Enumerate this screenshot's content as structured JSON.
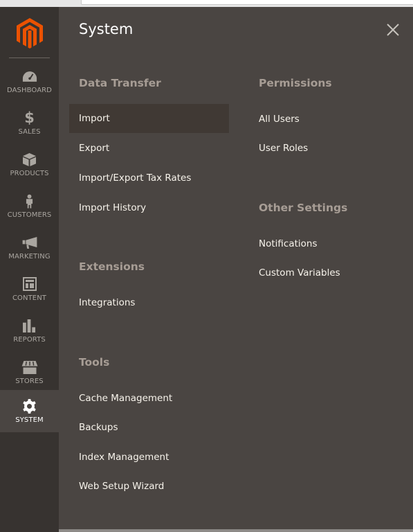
{
  "sidebar": {
    "logo": "magento-logo",
    "items": [
      {
        "label": "DASHBOARD",
        "icon": "dashboard-icon",
        "active": false
      },
      {
        "label": "SALES",
        "icon": "dollar-icon",
        "active": false
      },
      {
        "label": "PRODUCTS",
        "icon": "box-icon",
        "active": false
      },
      {
        "label": "CUSTOMERS",
        "icon": "person-icon",
        "active": false
      },
      {
        "label": "MARKETING",
        "icon": "megaphone-icon",
        "active": false
      },
      {
        "label": "CONTENT",
        "icon": "layout-icon",
        "active": false
      },
      {
        "label": "REPORTS",
        "icon": "bar-chart-icon",
        "active": false
      },
      {
        "label": "STORES",
        "icon": "storefront-icon",
        "active": false
      },
      {
        "label": "SYSTEM",
        "icon": "gear-icon",
        "active": true
      }
    ]
  },
  "panel": {
    "title": "System",
    "close_icon": "close-icon",
    "sections": {
      "data_transfer": {
        "title": "Data Transfer",
        "links": [
          "Import",
          "Export",
          "Import/Export Tax Rates",
          "Import History"
        ],
        "active_link": "Import"
      },
      "extensions": {
        "title": "Extensions",
        "links": [
          "Integrations"
        ]
      },
      "tools": {
        "title": "Tools",
        "links": [
          "Cache Management",
          "Backups",
          "Index Management",
          "Web Setup Wizard"
        ]
      },
      "permissions": {
        "title": "Permissions",
        "links": [
          "All Users",
          "User Roles"
        ]
      },
      "other_settings": {
        "title": "Other Settings",
        "links": [
          "Notifications",
          "Custom Variables"
        ]
      }
    }
  },
  "colors": {
    "brand_orange": "#eb5202",
    "sidebar_bg": "#373330",
    "panel_bg": "#4a4542",
    "active_link_bg": "#403934",
    "section_title": "#a79d95",
    "link_text": "#f7f3eb"
  }
}
